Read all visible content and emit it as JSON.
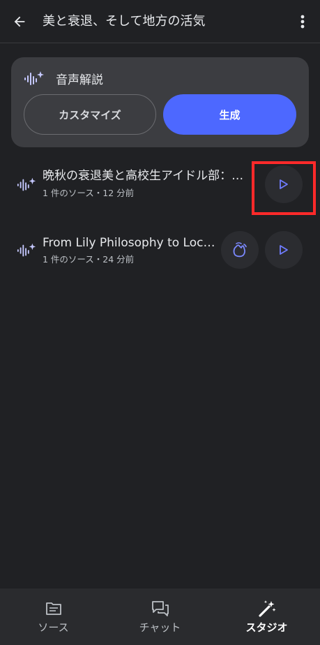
{
  "header": {
    "title": "美と衰退、そして地方の活気",
    "back_icon": "arrow-left-icon",
    "more_icon": "more-vert-icon"
  },
  "audio_overview": {
    "title": "音声解説",
    "icon": "audio-sparkle-icon",
    "customize_label": "カスタマイズ",
    "generate_label": "生成",
    "accent_color": "#4d68ff"
  },
  "items": [
    {
      "title": "晩秋の衰退美と高校生アイドル部：…",
      "meta": "1 件のソース・12 分前",
      "icon": "audio-sparkle-icon",
      "actions": [
        "play-icon"
      ]
    },
    {
      "title": "From Lily Philosophy to Loc…",
      "meta": "1 件のソース・24 分前",
      "icon": "audio-sparkle-icon",
      "actions": [
        "interactive-hand-icon",
        "play-icon"
      ]
    }
  ],
  "bottom_nav": [
    {
      "label": "ソース",
      "icon": "sources-icon",
      "active": false
    },
    {
      "label": "チャット",
      "icon": "chat-icon",
      "active": false
    },
    {
      "label": "スタジオ",
      "icon": "studio-wand-icon",
      "active": true
    }
  ],
  "colors": {
    "background": "#202124",
    "card": "#3c3d41",
    "highlight": "#ff2a2a"
  }
}
